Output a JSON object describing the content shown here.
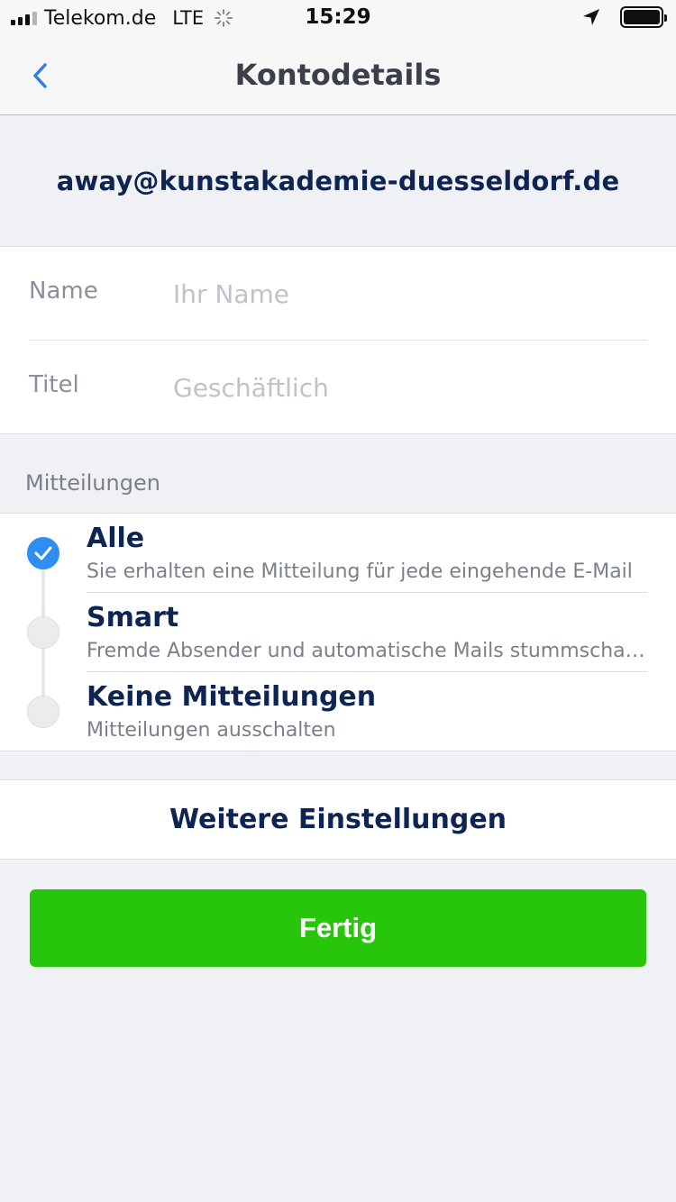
{
  "status_bar": {
    "carrier": "Telekom.de",
    "network": "LTE",
    "time": "15:29",
    "icons": [
      "signal-icon",
      "loading-spinner-icon",
      "location-arrow-icon",
      "battery-icon"
    ]
  },
  "nav": {
    "title": "Kontodetails",
    "back_icon": "chevron-left-icon",
    "accent_color": "#2f7fe0"
  },
  "account": {
    "email": "away@kunstakademie-duesseldorf.de"
  },
  "form": {
    "name_label": "Name",
    "name_value": "",
    "name_placeholder": "Ihr Name",
    "title_label": "Titel",
    "title_value": "",
    "title_placeholder": "Geschäftlich"
  },
  "notifications": {
    "section_label": "Mitteilungen",
    "selected_index": 0,
    "selected_color": "#2f8ef1",
    "options": [
      {
        "title": "Alle",
        "description": "Sie erhalten eine Mitteilung für jede eingehende E-Mail"
      },
      {
        "title": "Smart",
        "description": "Fremde Absender und automatische Mails stummschalten"
      },
      {
        "title": "Keine Mitteilungen",
        "description": "Mitteilungen ausschalten"
      }
    ]
  },
  "more_settings_label": "Weitere Einstellungen",
  "done_button": {
    "label": "Fertig",
    "color": "#27c60a"
  }
}
